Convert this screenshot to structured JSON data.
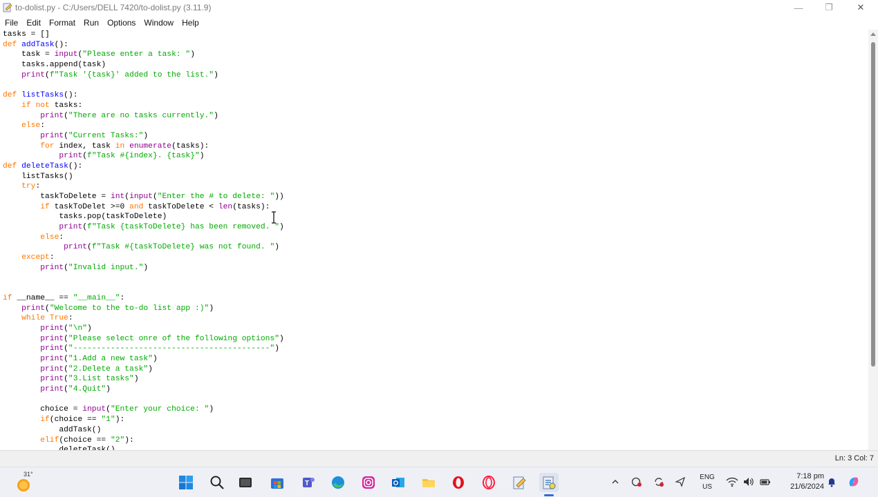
{
  "window": {
    "title": "to-dolist.py - C:/Users/DELL 7420/to-dolist.py (3.11.9)",
    "minimize": "—",
    "maximize": "❐",
    "close": "✕"
  },
  "menu": [
    "File",
    "Edit",
    "Format",
    "Run",
    "Options",
    "Window",
    "Help"
  ],
  "code_lines": [
    [
      [
        "tasks = []",
        ""
      ]
    ],
    [
      [
        "def ",
        "kw"
      ],
      [
        "addTask",
        "df"
      ],
      [
        "():",
        ""
      ]
    ],
    [
      [
        "    task = ",
        ""
      ],
      [
        "input",
        "bi"
      ],
      [
        "(",
        ""
      ],
      [
        "\"Please enter a task: \"",
        "st"
      ],
      [
        ")",
        ""
      ]
    ],
    [
      [
        "    tasks.append(task)",
        ""
      ]
    ],
    [
      [
        "    ",
        ""
      ],
      [
        "print",
        "bi"
      ],
      [
        "(",
        ""
      ],
      [
        "f\"Task '{task}' added to the list.\"",
        "st"
      ],
      [
        ")",
        ""
      ]
    ],
    [
      [
        "",
        ""
      ]
    ],
    [
      [
        "def ",
        "kw"
      ],
      [
        "listTasks",
        "df"
      ],
      [
        "():",
        ""
      ]
    ],
    [
      [
        "    ",
        ""
      ],
      [
        "if not ",
        "kw"
      ],
      [
        "tasks:",
        ""
      ]
    ],
    [
      [
        "        ",
        ""
      ],
      [
        "print",
        "bi"
      ],
      [
        "(",
        ""
      ],
      [
        "\"There are no tasks currently.\"",
        "st"
      ],
      [
        ")",
        ""
      ]
    ],
    [
      [
        "    ",
        ""
      ],
      [
        "else",
        "kw"
      ],
      [
        ":",
        ""
      ]
    ],
    [
      [
        "        ",
        ""
      ],
      [
        "print",
        "bi"
      ],
      [
        "(",
        ""
      ],
      [
        "\"Current Tasks:\"",
        "st"
      ],
      [
        ")",
        ""
      ]
    ],
    [
      [
        "        ",
        ""
      ],
      [
        "for ",
        "kw"
      ],
      [
        "index, task ",
        ""
      ],
      [
        "in ",
        "kw"
      ],
      [
        "enumerate",
        "bi"
      ],
      [
        "(tasks):",
        ""
      ]
    ],
    [
      [
        "            ",
        ""
      ],
      [
        "print",
        "bi"
      ],
      [
        "(",
        ""
      ],
      [
        "f\"Task #{index}. {task}\"",
        "st"
      ],
      [
        ")",
        ""
      ]
    ],
    [
      [
        "def ",
        "kw"
      ],
      [
        "deleteTask",
        "df"
      ],
      [
        "():",
        ""
      ]
    ],
    [
      [
        "    listTasks()",
        ""
      ]
    ],
    [
      [
        "    ",
        ""
      ],
      [
        "try",
        "kw"
      ],
      [
        ":",
        ""
      ]
    ],
    [
      [
        "        taskToDelete = ",
        ""
      ],
      [
        "int",
        "bi"
      ],
      [
        "(",
        ""
      ],
      [
        "input",
        "bi"
      ],
      [
        "(",
        ""
      ],
      [
        "\"Enter the # to delete: \"",
        "st"
      ],
      [
        "))",
        ""
      ]
    ],
    [
      [
        "        ",
        ""
      ],
      [
        "if ",
        "kw"
      ],
      [
        "taskToDelet >=0 ",
        ""
      ],
      [
        "and ",
        "kw"
      ],
      [
        "taskToDelete < ",
        ""
      ],
      [
        "len",
        "bi"
      ],
      [
        "(tasks):",
        ""
      ]
    ],
    [
      [
        "            tasks.pop(taskToDelete)",
        ""
      ]
    ],
    [
      [
        "            ",
        ""
      ],
      [
        "print",
        "bi"
      ],
      [
        "(",
        ""
      ],
      [
        "f\"Task {taskToDelete} has been removed. \"",
        "st"
      ],
      [
        ")",
        ""
      ]
    ],
    [
      [
        "        ",
        ""
      ],
      [
        "else",
        "kw"
      ],
      [
        ":",
        ""
      ]
    ],
    [
      [
        "             ",
        ""
      ],
      [
        "print",
        "bi"
      ],
      [
        "(",
        ""
      ],
      [
        "f\"Task #{taskToDelete} was not found. \"",
        "st"
      ],
      [
        ")",
        ""
      ]
    ],
    [
      [
        "    ",
        ""
      ],
      [
        "except",
        "kw"
      ],
      [
        ":",
        ""
      ]
    ],
    [
      [
        "        ",
        ""
      ],
      [
        "print",
        "bi"
      ],
      [
        "(",
        ""
      ],
      [
        "\"Invalid input.\"",
        "st"
      ],
      [
        ")",
        ""
      ]
    ],
    [
      [
        "",
        ""
      ]
    ],
    [
      [
        "",
        ""
      ]
    ],
    [
      [
        "if ",
        "kw"
      ],
      [
        "__name__ == ",
        ""
      ],
      [
        "\"__main__\"",
        "st"
      ],
      [
        ":",
        ""
      ]
    ],
    [
      [
        "    ",
        ""
      ],
      [
        "print",
        "bi"
      ],
      [
        "(",
        ""
      ],
      [
        "\"Welcome to the to-do list app :)\"",
        "st"
      ],
      [
        ")",
        ""
      ]
    ],
    [
      [
        "    ",
        ""
      ],
      [
        "while True",
        "kw"
      ],
      [
        ":",
        ""
      ]
    ],
    [
      [
        "        ",
        ""
      ],
      [
        "print",
        "bi"
      ],
      [
        "(",
        ""
      ],
      [
        "\"\\n\"",
        "st"
      ],
      [
        ")",
        ""
      ]
    ],
    [
      [
        "        ",
        ""
      ],
      [
        "print",
        "bi"
      ],
      [
        "(",
        ""
      ],
      [
        "\"Please select onre of the following options\"",
        "st"
      ],
      [
        ")",
        ""
      ]
    ],
    [
      [
        "        ",
        ""
      ],
      [
        "print",
        "bi"
      ],
      [
        "(",
        ""
      ],
      [
        "\"------------------------------------------\"",
        "st"
      ],
      [
        ")",
        ""
      ]
    ],
    [
      [
        "        ",
        ""
      ],
      [
        "print",
        "bi"
      ],
      [
        "(",
        ""
      ],
      [
        "\"1.Add a new task\"",
        "st"
      ],
      [
        ")",
        ""
      ]
    ],
    [
      [
        "        ",
        ""
      ],
      [
        "print",
        "bi"
      ],
      [
        "(",
        ""
      ],
      [
        "\"2.Delete a task\"",
        "st"
      ],
      [
        ")",
        ""
      ]
    ],
    [
      [
        "        ",
        ""
      ],
      [
        "print",
        "bi"
      ],
      [
        "(",
        ""
      ],
      [
        "\"3.List tasks\"",
        "st"
      ],
      [
        ")",
        ""
      ]
    ],
    [
      [
        "        ",
        ""
      ],
      [
        "print",
        "bi"
      ],
      [
        "(",
        ""
      ],
      [
        "\"4.Quit\"",
        "st"
      ],
      [
        ")",
        ""
      ]
    ],
    [
      [
        "",
        ""
      ]
    ],
    [
      [
        "        choice = ",
        ""
      ],
      [
        "input",
        "bi"
      ],
      [
        "(",
        ""
      ],
      [
        "\"Enter your choice: \"",
        "st"
      ],
      [
        ")",
        ""
      ]
    ],
    [
      [
        "        ",
        ""
      ],
      [
        "if",
        "kw"
      ],
      [
        "(choice == ",
        ""
      ],
      [
        "\"1\"",
        "st"
      ],
      [
        "):",
        ""
      ]
    ],
    [
      [
        "            addTask()",
        ""
      ]
    ],
    [
      [
        "        ",
        ""
      ],
      [
        "elif",
        "kw"
      ],
      [
        "(choice == ",
        ""
      ],
      [
        "\"2\"",
        "st"
      ],
      [
        "):",
        ""
      ]
    ],
    [
      [
        "            deleteTask()",
        ""
      ]
    ]
  ],
  "syntax_colors": {
    "keyword": "#ff7700",
    "builtin": "#900090",
    "string": "#00aa00",
    "definition": "#0000ff"
  },
  "status": {
    "position": "Ln: 3   Col: 7"
  },
  "taskbar": {
    "weather_temp": "31°",
    "icons": [
      "windows-start-icon",
      "search-icon",
      "task-view-icon",
      "store-icon",
      "teams-icon",
      "edge-icon",
      "instagram-icon",
      "outlook-icon",
      "file-explorer-icon",
      "opera-icon",
      "opera-gx-icon",
      "idle-editor-icon",
      "python-idle-icon"
    ],
    "tray_icons": [
      "chevron-up-icon",
      "network-monitor-icon",
      "sync-icon",
      "location-icon"
    ],
    "lang_line1": "ENG",
    "lang_line2": "US",
    "time": "7:18 pm",
    "date": "21/6/2024"
  }
}
